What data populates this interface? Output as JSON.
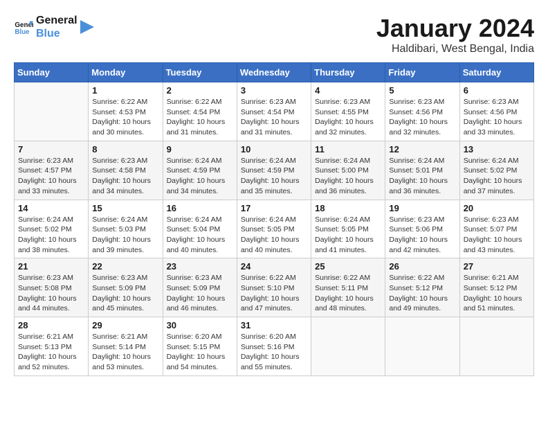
{
  "logo": {
    "text_general": "General",
    "text_blue": "Blue"
  },
  "title": "January 2024",
  "location": "Haldibari, West Bengal, India",
  "days_header": [
    "Sunday",
    "Monday",
    "Tuesday",
    "Wednesday",
    "Thursday",
    "Friday",
    "Saturday"
  ],
  "weeks": [
    [
      {
        "day": "",
        "sunrise": "",
        "sunset": "",
        "daylight": ""
      },
      {
        "day": "1",
        "sunrise": "Sunrise: 6:22 AM",
        "sunset": "Sunset: 4:53 PM",
        "daylight": "Daylight: 10 hours and 30 minutes."
      },
      {
        "day": "2",
        "sunrise": "Sunrise: 6:22 AM",
        "sunset": "Sunset: 4:54 PM",
        "daylight": "Daylight: 10 hours and 31 minutes."
      },
      {
        "day": "3",
        "sunrise": "Sunrise: 6:23 AM",
        "sunset": "Sunset: 4:54 PM",
        "daylight": "Daylight: 10 hours and 31 minutes."
      },
      {
        "day": "4",
        "sunrise": "Sunrise: 6:23 AM",
        "sunset": "Sunset: 4:55 PM",
        "daylight": "Daylight: 10 hours and 32 minutes."
      },
      {
        "day": "5",
        "sunrise": "Sunrise: 6:23 AM",
        "sunset": "Sunset: 4:56 PM",
        "daylight": "Daylight: 10 hours and 32 minutes."
      },
      {
        "day": "6",
        "sunrise": "Sunrise: 6:23 AM",
        "sunset": "Sunset: 4:56 PM",
        "daylight": "Daylight: 10 hours and 33 minutes."
      }
    ],
    [
      {
        "day": "7",
        "sunrise": "Sunrise: 6:23 AM",
        "sunset": "Sunset: 4:57 PM",
        "daylight": "Daylight: 10 hours and 33 minutes."
      },
      {
        "day": "8",
        "sunrise": "Sunrise: 6:23 AM",
        "sunset": "Sunset: 4:58 PM",
        "daylight": "Daylight: 10 hours and 34 minutes."
      },
      {
        "day": "9",
        "sunrise": "Sunrise: 6:24 AM",
        "sunset": "Sunset: 4:59 PM",
        "daylight": "Daylight: 10 hours and 34 minutes."
      },
      {
        "day": "10",
        "sunrise": "Sunrise: 6:24 AM",
        "sunset": "Sunset: 4:59 PM",
        "daylight": "Daylight: 10 hours and 35 minutes."
      },
      {
        "day": "11",
        "sunrise": "Sunrise: 6:24 AM",
        "sunset": "Sunset: 5:00 PM",
        "daylight": "Daylight: 10 hours and 36 minutes."
      },
      {
        "day": "12",
        "sunrise": "Sunrise: 6:24 AM",
        "sunset": "Sunset: 5:01 PM",
        "daylight": "Daylight: 10 hours and 36 minutes."
      },
      {
        "day": "13",
        "sunrise": "Sunrise: 6:24 AM",
        "sunset": "Sunset: 5:02 PM",
        "daylight": "Daylight: 10 hours and 37 minutes."
      }
    ],
    [
      {
        "day": "14",
        "sunrise": "Sunrise: 6:24 AM",
        "sunset": "Sunset: 5:02 PM",
        "daylight": "Daylight: 10 hours and 38 minutes."
      },
      {
        "day": "15",
        "sunrise": "Sunrise: 6:24 AM",
        "sunset": "Sunset: 5:03 PM",
        "daylight": "Daylight: 10 hours and 39 minutes."
      },
      {
        "day": "16",
        "sunrise": "Sunrise: 6:24 AM",
        "sunset": "Sunset: 5:04 PM",
        "daylight": "Daylight: 10 hours and 40 minutes."
      },
      {
        "day": "17",
        "sunrise": "Sunrise: 6:24 AM",
        "sunset": "Sunset: 5:05 PM",
        "daylight": "Daylight: 10 hours and 40 minutes."
      },
      {
        "day": "18",
        "sunrise": "Sunrise: 6:24 AM",
        "sunset": "Sunset: 5:05 PM",
        "daylight": "Daylight: 10 hours and 41 minutes."
      },
      {
        "day": "19",
        "sunrise": "Sunrise: 6:23 AM",
        "sunset": "Sunset: 5:06 PM",
        "daylight": "Daylight: 10 hours and 42 minutes."
      },
      {
        "day": "20",
        "sunrise": "Sunrise: 6:23 AM",
        "sunset": "Sunset: 5:07 PM",
        "daylight": "Daylight: 10 hours and 43 minutes."
      }
    ],
    [
      {
        "day": "21",
        "sunrise": "Sunrise: 6:23 AM",
        "sunset": "Sunset: 5:08 PM",
        "daylight": "Daylight: 10 hours and 44 minutes."
      },
      {
        "day": "22",
        "sunrise": "Sunrise: 6:23 AM",
        "sunset": "Sunset: 5:09 PM",
        "daylight": "Daylight: 10 hours and 45 minutes."
      },
      {
        "day": "23",
        "sunrise": "Sunrise: 6:23 AM",
        "sunset": "Sunset: 5:09 PM",
        "daylight": "Daylight: 10 hours and 46 minutes."
      },
      {
        "day": "24",
        "sunrise": "Sunrise: 6:22 AM",
        "sunset": "Sunset: 5:10 PM",
        "daylight": "Daylight: 10 hours and 47 minutes."
      },
      {
        "day": "25",
        "sunrise": "Sunrise: 6:22 AM",
        "sunset": "Sunset: 5:11 PM",
        "daylight": "Daylight: 10 hours and 48 minutes."
      },
      {
        "day": "26",
        "sunrise": "Sunrise: 6:22 AM",
        "sunset": "Sunset: 5:12 PM",
        "daylight": "Daylight: 10 hours and 49 minutes."
      },
      {
        "day": "27",
        "sunrise": "Sunrise: 6:21 AM",
        "sunset": "Sunset: 5:12 PM",
        "daylight": "Daylight: 10 hours and 51 minutes."
      }
    ],
    [
      {
        "day": "28",
        "sunrise": "Sunrise: 6:21 AM",
        "sunset": "Sunset: 5:13 PM",
        "daylight": "Daylight: 10 hours and 52 minutes."
      },
      {
        "day": "29",
        "sunrise": "Sunrise: 6:21 AM",
        "sunset": "Sunset: 5:14 PM",
        "daylight": "Daylight: 10 hours and 53 minutes."
      },
      {
        "day": "30",
        "sunrise": "Sunrise: 6:20 AM",
        "sunset": "Sunset: 5:15 PM",
        "daylight": "Daylight: 10 hours and 54 minutes."
      },
      {
        "day": "31",
        "sunrise": "Sunrise: 6:20 AM",
        "sunset": "Sunset: 5:16 PM",
        "daylight": "Daylight: 10 hours and 55 minutes."
      },
      {
        "day": "",
        "sunrise": "",
        "sunset": "",
        "daylight": ""
      },
      {
        "day": "",
        "sunrise": "",
        "sunset": "",
        "daylight": ""
      },
      {
        "day": "",
        "sunrise": "",
        "sunset": "",
        "daylight": ""
      }
    ]
  ]
}
